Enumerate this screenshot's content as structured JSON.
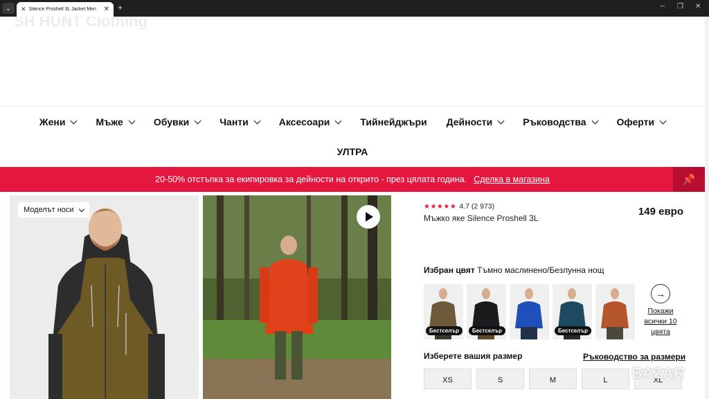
{
  "browser": {
    "tab_title": "Silence Proshell 3L Jacket Men",
    "tab_favicon": "✕",
    "tab_close": "✕",
    "new_tab": "+",
    "menu_icon": "⌄",
    "win_min": "─",
    "win_max": "❐",
    "win_close": "✕"
  },
  "header": {
    "logo_ghost": "SH HUNT Clothing"
  },
  "nav": {
    "items": [
      {
        "label": "Жени",
        "dropdown": true
      },
      {
        "label": "Мъже",
        "dropdown": true
      },
      {
        "label": "Обувки",
        "dropdown": true
      },
      {
        "label": "Чанти",
        "dropdown": true
      },
      {
        "label": "Аксесоари",
        "dropdown": true
      },
      {
        "label": "Тийнейджъри",
        "dropdown": false
      },
      {
        "label": "Дейности",
        "dropdown": true
      },
      {
        "label": "Ръководства",
        "dropdown": true
      },
      {
        "label": "Оферти",
        "dropdown": true
      }
    ],
    "ultra": "УЛТРА"
  },
  "promo": {
    "text": "20-50% отстъпка за екипировка за дейности на открито - през цялата година.",
    "link": "Сделка в магазина",
    "pin_icon": "📌"
  },
  "gallery": {
    "model_wears": "Моделът носи"
  },
  "product": {
    "stars": "★★★★★",
    "rating": "4.7",
    "reviews": "(2 973)",
    "name": "Мъжко яке Silence Proshell 3L",
    "price": "149 евро"
  },
  "color": {
    "label": "Избран цвят",
    "value": "Тъмно маслинено/Безлунна нощ",
    "swatches": [
      {
        "badge": "Бестселър",
        "jacket": "#6e5a3a",
        "pants": "#3a3a30"
      },
      {
        "badge": "Бестселър",
        "jacket": "#1b1b1d",
        "pants": "#5a4a2a"
      },
      {
        "badge": "",
        "jacket": "#1f4fb8",
        "pants": "#22304a"
      },
      {
        "badge": "Бестселър",
        "jacket": "#1d4a60",
        "pants": "#2a2a2a"
      },
      {
        "badge": "",
        "jacket": "#b4552a",
        "pants": "#4a4a3a"
      }
    ],
    "show_all_arrow": "→",
    "show_all": "Покажи всички 10 цвята"
  },
  "size": {
    "label": "Изберете вашия размер",
    "guide": "Ръководство за размери",
    "options": [
      "XS",
      "S",
      "M",
      "L",
      "XL"
    ]
  },
  "watermark": "BAZAR",
  "colors": {
    "promo": "#e5173f",
    "stars": "#e5173f"
  }
}
